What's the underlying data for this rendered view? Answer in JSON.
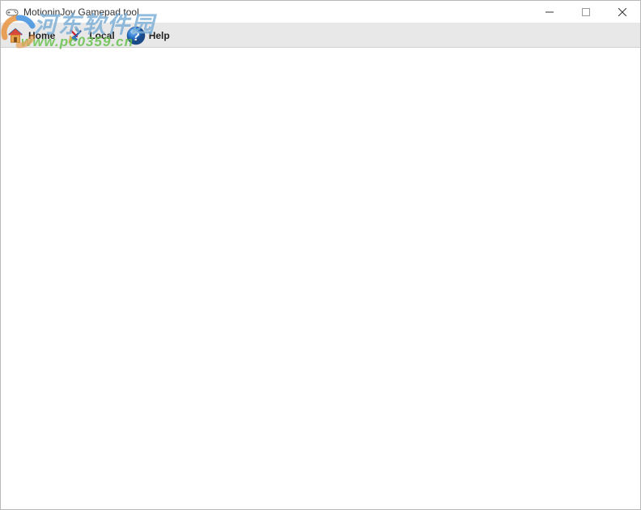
{
  "window": {
    "title": "MotioninJoy Gamepad tool"
  },
  "toolbar": {
    "home": "Home",
    "local": "Local",
    "help": "Help"
  },
  "watermark": {
    "text_zh": "河东软件园",
    "url": "www.pc0359.cn"
  }
}
